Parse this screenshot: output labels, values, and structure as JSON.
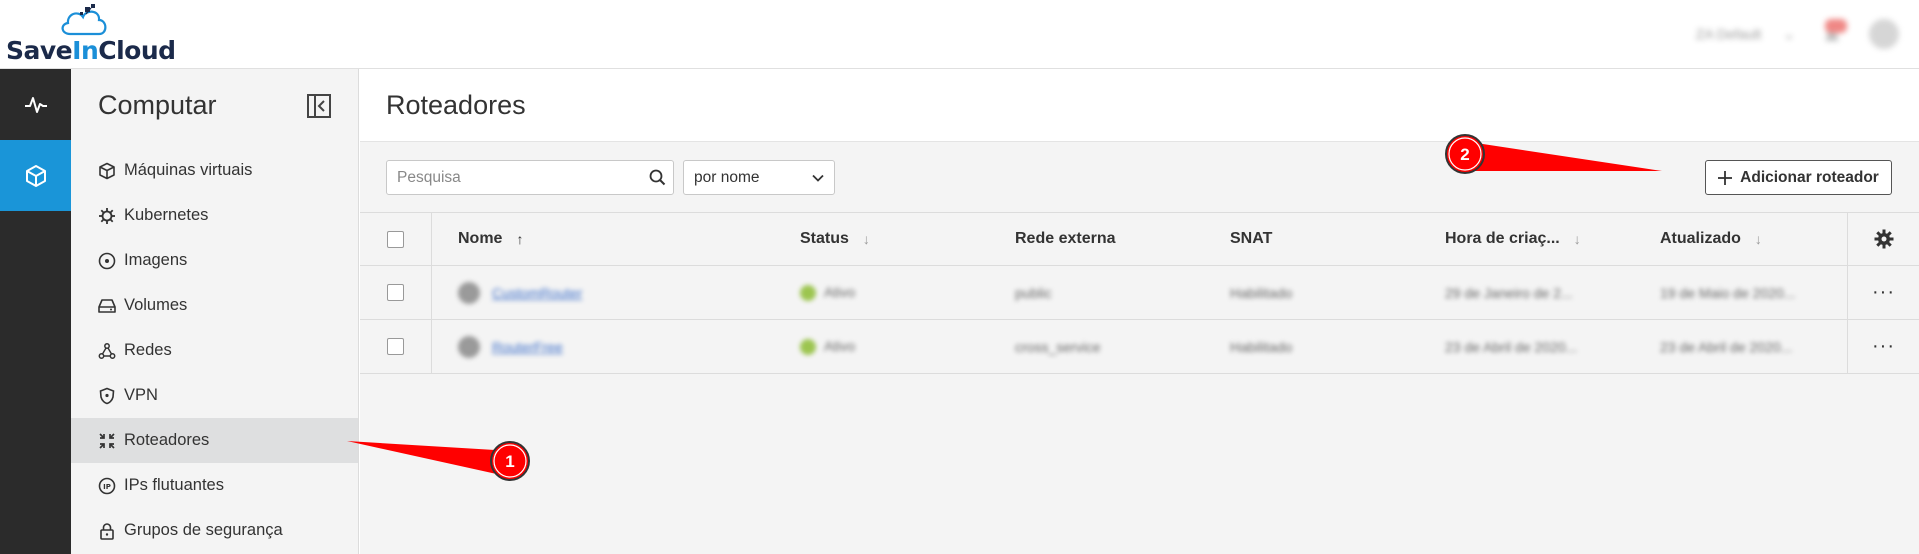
{
  "brand": {
    "logo_text_prefix": "Save",
    "logo_text_in": "In",
    "logo_text_suffix": "Cloud"
  },
  "header": {
    "region": "ZA Default"
  },
  "sidebar": {
    "title": "Computar",
    "items": [
      {
        "label": "Máquinas virtuais",
        "icon": "cube-icon"
      },
      {
        "label": "Kubernetes",
        "icon": "helm-icon"
      },
      {
        "label": "Imagens",
        "icon": "disc-icon"
      },
      {
        "label": "Volumes",
        "icon": "hard-drive-icon"
      },
      {
        "label": "Redes",
        "icon": "network-icon"
      },
      {
        "label": "VPN",
        "icon": "shield-icon"
      },
      {
        "label": "Roteadores",
        "icon": "router-icon",
        "active": true
      },
      {
        "label": "IPs flutuantes",
        "icon": "floating-ip-icon"
      },
      {
        "label": "Grupos de segurança",
        "icon": "lock-icon"
      }
    ]
  },
  "main": {
    "title": "Roteadores",
    "search_placeholder": "Pesquisa",
    "sort_value": "por nome",
    "add_button_label": "Adicionar roteador"
  },
  "table": {
    "columns": [
      "Nome",
      "Status",
      "Rede externa",
      "SNAT",
      "Hora de criaç...",
      "Atualizado"
    ],
    "rows": [
      {
        "name": "CustomRouter",
        "status": "Ativo",
        "network": "public",
        "snat": "Habilitado",
        "created": "29 de Janeiro de 2...",
        "updated": "19 de Maio de 2020..."
      },
      {
        "name": "RouterFree",
        "status": "Ativo",
        "network": "cross_service",
        "snat": "Habilitado",
        "created": "23 de Abril de 2020...",
        "updated": "23 de Abril de 2020..."
      }
    ]
  },
  "annotations": {
    "step1": "1",
    "step2": "2",
    "color": "#ff0000"
  },
  "colors": {
    "accent": "#1a95d8",
    "rail": "#2b2b2b",
    "active_nav": "#dedfe0",
    "status_ok": "#9cc54f"
  }
}
